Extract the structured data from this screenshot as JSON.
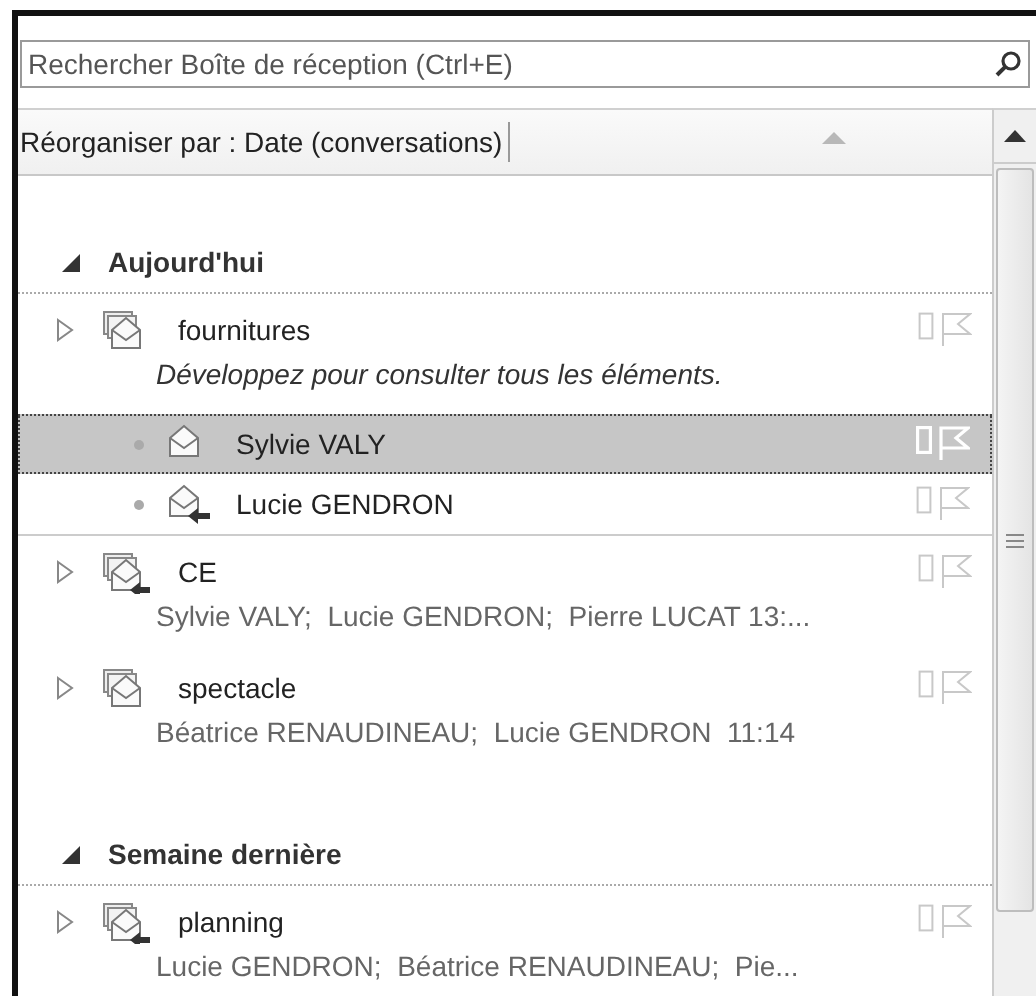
{
  "search": {
    "placeholder": "Rechercher Boîte de réception (Ctrl+E)"
  },
  "arrange": {
    "label": "Réorganiser par : Date (conversations)"
  },
  "groups": [
    {
      "label": "Aujourd'hui",
      "expanded": true,
      "conversations": [
        {
          "subject": "fournitures",
          "expanded": false,
          "replied": false,
          "selected": false,
          "note": "Développez pour consulter tous les éléments.",
          "messages": [
            {
              "sender": "Sylvie VALY",
              "replied": false,
              "selected": true
            },
            {
              "sender": "Lucie GENDRON",
              "replied": true,
              "selected": false
            }
          ]
        },
        {
          "subject": "CE",
          "expanded": false,
          "replied": true,
          "selected": false,
          "senders": "Sylvie VALY;  Lucie GENDRON;  Pierre LUCAT 13:..."
        },
        {
          "subject": "spectacle",
          "expanded": false,
          "replied": false,
          "selected": false,
          "senders": "Béatrice RENAUDINEAU;  Lucie GENDRON  11:14"
        }
      ]
    },
    {
      "label": "Semaine dernière",
      "expanded": true,
      "conversations": [
        {
          "subject": "planning",
          "expanded": false,
          "replied": true,
          "selected": false,
          "senders": "Lucie GENDRON;  Béatrice RENAUDINEAU;  Pie..."
        }
      ]
    }
  ]
}
